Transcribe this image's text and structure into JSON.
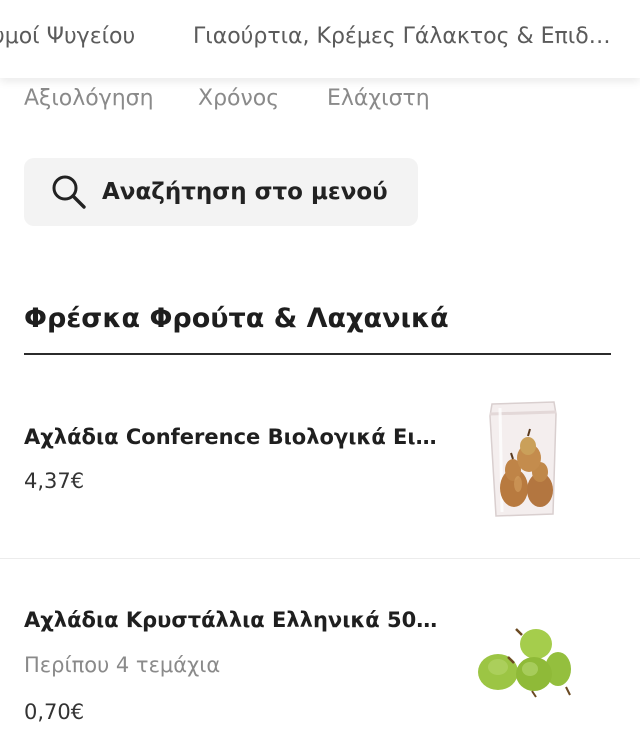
{
  "category_tabs": [
    {
      "label": "υμοί Ψυγείου"
    },
    {
      "label": "Γιαούρτια, Κρέμες Γάλακτος & Επιδ…"
    }
  ],
  "sort_options": [
    {
      "label": "Αξιολόγηση"
    },
    {
      "label": "Χρόνος"
    },
    {
      "label": "Ελάχιστη"
    }
  ],
  "search": {
    "label": "Αναζήτηση στο μενού",
    "icon": "search-icon"
  },
  "section": {
    "title": "Φρέσκα Φρούτα & Λαχανικά"
  },
  "products": [
    {
      "name": "Αχλάδια Conference Βιολογικά Ει…",
      "description": "",
      "price": "4,37€",
      "image": "packaged-pears-image"
    },
    {
      "name": "Αχλάδια Κρυστάλλια Ελληνικά 50…",
      "description": "Περίπου 4 τεμάχια",
      "price": "0,70€",
      "image": "green-pears-image"
    }
  ],
  "colors": {
    "search_background": "#f3f3f3",
    "muted_text": "#8a8a8a",
    "primary_text": "#222222"
  }
}
